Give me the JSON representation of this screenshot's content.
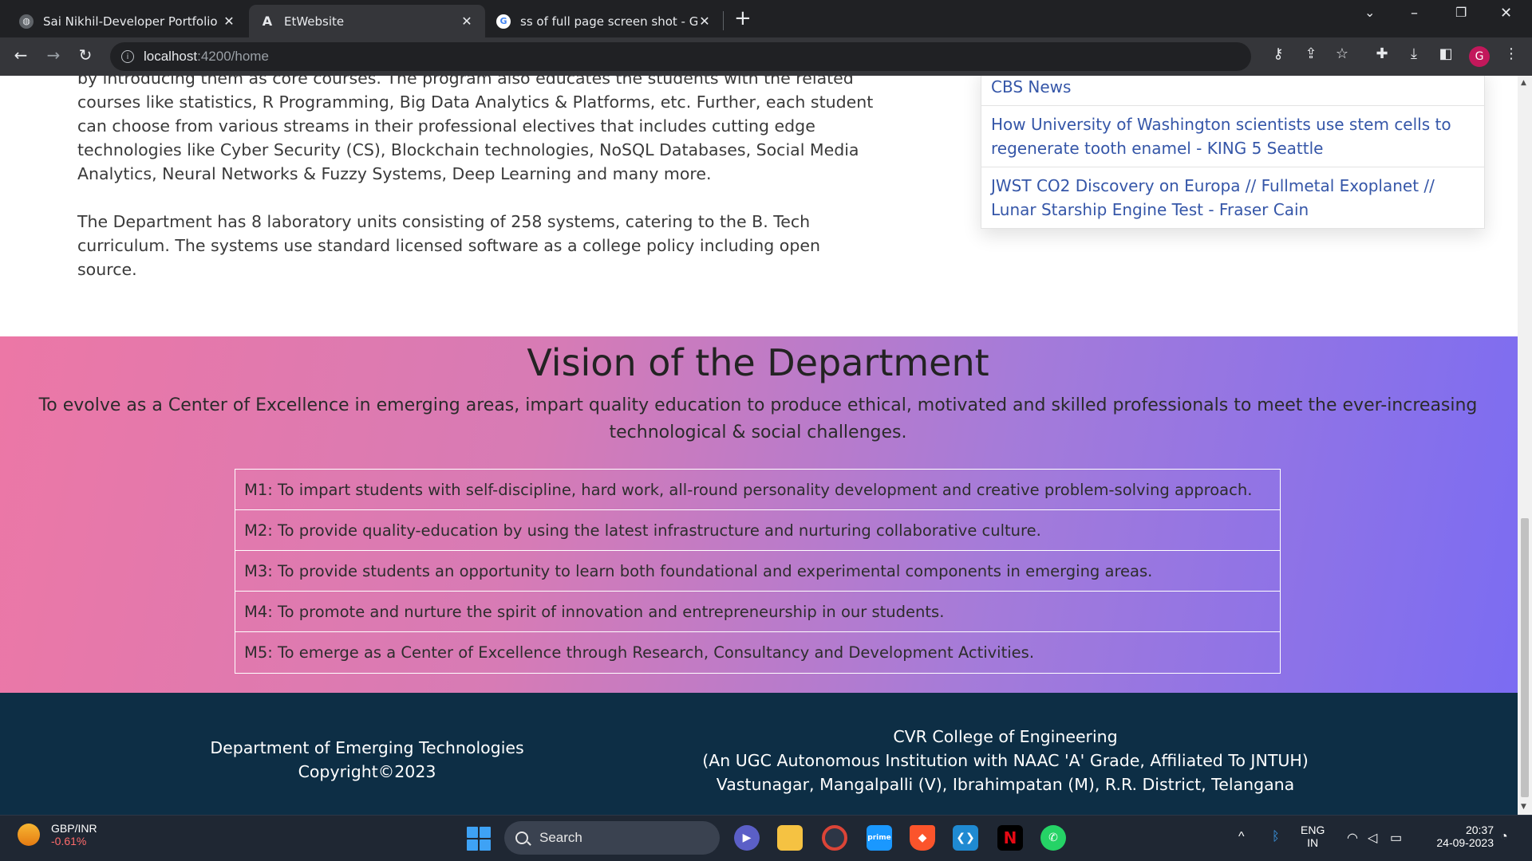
{
  "browser": {
    "tabs": [
      {
        "title": "Sai Nikhil-Developer Portfolio",
        "favicon": "globe-icon",
        "active": false
      },
      {
        "title": "EtWebsite",
        "favicon": "angular-icon",
        "active": true
      },
      {
        "title": "ss of full page screen shot - Goog",
        "favicon": "google-icon",
        "active": false
      }
    ],
    "url_host": "localhost",
    "url_path": ":4200/home",
    "profile_initial": "G"
  },
  "about": {
    "paragraph1_line0": "by introducing them as core courses. The program also educates the students with the related",
    "paragraph1": "courses like statistics, R Programming, Big Data Analytics & Platforms, etc. Further, each student can choose from various streams in their professional electives that includes cutting edge technologies like Cyber Security (CS), Blockchain technologies, NoSQL Databases, Social Media Analytics, Neural Networks & Fuzzy Systems, Deep Learning and many more.",
    "paragraph2": "The Department has 8 laboratory units consisting of 258 systems, catering to the B. Tech curriculum. The systems use standard licensed software as a college policy including open source."
  },
  "news": {
    "items": [
      "CBS News",
      "How University of Washington scientists use stem cells to regenerate tooth enamel - KING 5 Seattle",
      "JWST CO2 Discovery on Europa // Fullmetal Exoplanet // Lunar Starship Engine Test - Fraser Cain"
    ]
  },
  "vision": {
    "title": "Vision of the Department",
    "text": "To evolve as a Center of Excellence in emerging areas, impart quality education to produce ethical, motivated and skilled professionals to meet the ever-increasing technological & social challenges.",
    "missions": [
      "M1: To impart students with self-discipline, hard work, all-round personality development and creative problem-solving approach.",
      "M2: To provide quality-education by using the latest infrastructure and nurturing collaborative culture.",
      "M3: To provide students an opportunity to learn both foundational and experimental components in emerging areas.",
      "M4: To promote and nurture the spirit of innovation and entrepreneurship in our students.",
      "M5: To emerge as a Center of Excellence through Research, Consultancy and Development Activities."
    ]
  },
  "footer": {
    "dept": "Department of Emerging Technologies",
    "copyright": "Copyright©2023",
    "college": "CVR College of Engineering",
    "affiliation": "(An UGC Autonomous Institution with NAAC 'A' Grade, Affiliated To JNTUH)",
    "address": "Vastunagar, Mangalpalli (V), Ibrahimpatan (M), R.R. District, Telangana"
  },
  "taskbar": {
    "ticker_symbol": "GBP/INR",
    "ticker_change": "-0.61%",
    "search_label": "Search",
    "lang_1": "ENG",
    "lang_2": "IN",
    "time": "20:37",
    "date": "24-09-2023"
  },
  "colors": {
    "footer_bg": "#0d2e45",
    "news_link": "#3556a8",
    "gradient_start": "#ec77a6",
    "gradient_end": "#7b6cf2"
  }
}
